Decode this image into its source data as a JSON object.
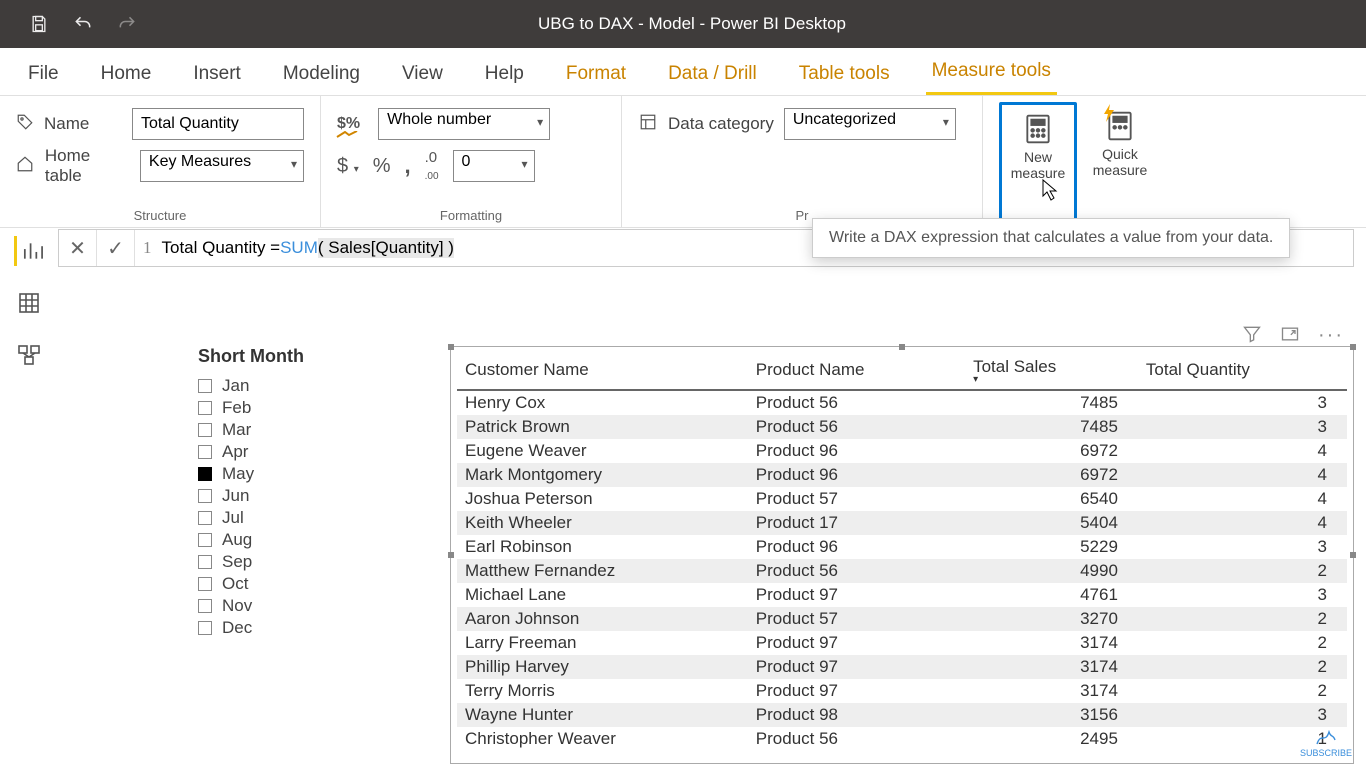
{
  "titlebar": {
    "title": "UBG to DAX - Model - Power BI Desktop"
  },
  "tabs": {
    "file": "File",
    "home": "Home",
    "insert": "Insert",
    "modeling": "Modeling",
    "view": "View",
    "help": "Help",
    "format": "Format",
    "datadrill": "Data / Drill",
    "tabletools": "Table tools",
    "measuretools": "Measure tools"
  },
  "ribbon": {
    "name_label": "Name",
    "name_value": "Total Quantity",
    "home_table_label": "Home table",
    "home_table_value": "Key Measures",
    "structure_label": "Structure",
    "format_select": "Whole number",
    "format_decimals": "0",
    "formatting_label": "Formatting",
    "datacat_label": "Data category",
    "datacat_value": "Uncategorized",
    "properties_label": "Pr",
    "new_measure": "New measure",
    "quick_measure": "Quick measure",
    "tooltip": "Write a DAX expression that calculates a value from your data."
  },
  "formula": {
    "line": "1",
    "pre": "Total Quantity = ",
    "func": "SUM",
    "args": "( Sales[Quantity] )"
  },
  "slicer": {
    "title": "Short Month",
    "items": [
      {
        "label": "Jan",
        "sel": false
      },
      {
        "label": "Feb",
        "sel": false
      },
      {
        "label": "Mar",
        "sel": false
      },
      {
        "label": "Apr",
        "sel": false
      },
      {
        "label": "May",
        "sel": true
      },
      {
        "label": "Jun",
        "sel": false
      },
      {
        "label": "Jul",
        "sel": false
      },
      {
        "label": "Aug",
        "sel": false
      },
      {
        "label": "Sep",
        "sel": false
      },
      {
        "label": "Oct",
        "sel": false
      },
      {
        "label": "Nov",
        "sel": false
      },
      {
        "label": "Dec",
        "sel": false
      }
    ]
  },
  "table": {
    "columns": [
      "Customer Name",
      "Product Name",
      "Total Sales",
      "Total Quantity"
    ],
    "sort_col": 2,
    "rows": [
      [
        "Henry Cox",
        "Product 56",
        "7485",
        "3"
      ],
      [
        "Patrick Brown",
        "Product 56",
        "7485",
        "3"
      ],
      [
        "Eugene Weaver",
        "Product 96",
        "6972",
        "4"
      ],
      [
        "Mark Montgomery",
        "Product 96",
        "6972",
        "4"
      ],
      [
        "Joshua Peterson",
        "Product 57",
        "6540",
        "4"
      ],
      [
        "Keith Wheeler",
        "Product 17",
        "5404",
        "4"
      ],
      [
        "Earl Robinson",
        "Product 96",
        "5229",
        "3"
      ],
      [
        "Matthew Fernandez",
        "Product 56",
        "4990",
        "2"
      ],
      [
        "Michael Lane",
        "Product 97",
        "4761",
        "3"
      ],
      [
        "Aaron Johnson",
        "Product 57",
        "3270",
        "2"
      ],
      [
        "Larry Freeman",
        "Product 97",
        "3174",
        "2"
      ],
      [
        "Phillip Harvey",
        "Product 97",
        "3174",
        "2"
      ],
      [
        "Terry Morris",
        "Product 97",
        "3174",
        "2"
      ],
      [
        "Wayne Hunter",
        "Product 98",
        "3156",
        "3"
      ],
      [
        "Christopher Weaver",
        "Product 56",
        "2495",
        "1"
      ]
    ]
  },
  "watermark": "SUBSCRIBE"
}
